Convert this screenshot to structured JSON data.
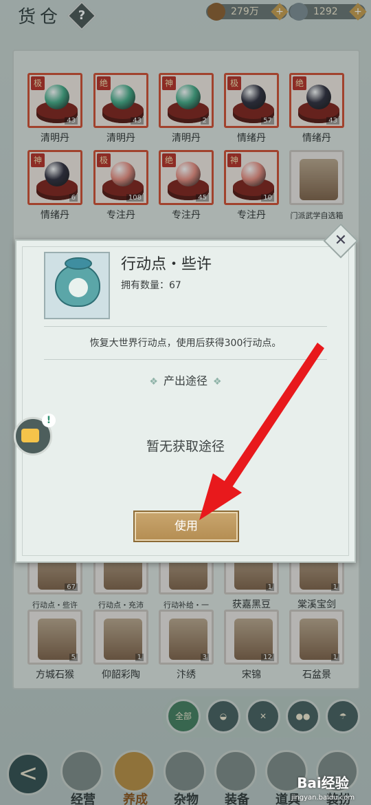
{
  "header": {
    "title": "货仓",
    "help_label": "?",
    "currencies": [
      {
        "icon": "copper-coin-icon",
        "value": "279万",
        "plus": "+"
      },
      {
        "icon": "silver-ingot-icon",
        "value": "1292",
        "plus": "+"
      }
    ]
  },
  "inventory": {
    "items": [
      {
        "name": "清明丹",
        "rank": "极",
        "count": "43",
        "orb_color": "#3fa883"
      },
      {
        "name": "清明丹",
        "rank": "绝",
        "count": "43",
        "orb_color": "#3fa883"
      },
      {
        "name": "清明丹",
        "rank": "神",
        "count": "2",
        "orb_color": "#3fa883"
      },
      {
        "name": "情绪丹",
        "rank": "极",
        "count": "57",
        "orb_color": "#2a2838"
      },
      {
        "name": "情绪丹",
        "rank": "绝",
        "count": "43",
        "orb_color": "#2a2838"
      },
      {
        "name": "情绪丹",
        "rank": "神",
        "count": "6",
        "orb_color": "#2a2838"
      },
      {
        "name": "专注丹",
        "rank": "极",
        "count": "108",
        "orb_color": "#e8897c"
      },
      {
        "name": "专注丹",
        "rank": "绝",
        "count": "45",
        "orb_color": "#e8897c"
      },
      {
        "name": "专注丹",
        "rank": "神",
        "count": "10",
        "orb_color": "#e8897c"
      },
      {
        "name": "门派武学自选箱",
        "rank": "",
        "count": "",
        "orb_color": ""
      },
      {
        "name": "行动点・些许",
        "count": "67"
      },
      {
        "name": "行动点・充沛",
        "count": ""
      },
      {
        "name": "行动补给・一",
        "count": ""
      },
      {
        "name": "获嘉黑豆",
        "count": "1"
      },
      {
        "name": "棠溪宝剑",
        "count": "1"
      },
      {
        "name": "方城石猴",
        "count": "5"
      },
      {
        "name": "仰韶彩陶",
        "count": "1"
      },
      {
        "name": "汴绣",
        "count": "3"
      },
      {
        "name": "宋锦",
        "count": "12"
      },
      {
        "name": "石盆景",
        "count": "1"
      }
    ]
  },
  "filter_tabs": [
    {
      "label": "全部",
      "icon": "all-icon",
      "active": true
    },
    {
      "label": "",
      "icon": "bag-icon",
      "active": false
    },
    {
      "label": "",
      "icon": "tools-icon",
      "active": false
    },
    {
      "label": "",
      "icon": "food-icon",
      "active": false
    },
    {
      "label": "",
      "icon": "umbrella-icon",
      "active": false
    }
  ],
  "bottom_nav": [
    {
      "label": "经营",
      "icon": "bowl-icon",
      "active": false
    },
    {
      "label": "养成",
      "icon": "orb-icon",
      "active": true
    },
    {
      "label": "杂物",
      "icon": "sticks-icon",
      "active": false
    },
    {
      "label": "装备",
      "icon": "robe-icon",
      "active": false
    },
    {
      "label": "道具",
      "icon": "box-icon",
      "active": false
    },
    {
      "label": "装扮",
      "icon": "house-icon",
      "active": false
    }
  ],
  "back_label": "<",
  "modal": {
    "title": "行动点・些许",
    "owned_label": "拥有数量：",
    "owned_value": "67",
    "description": "恢复大世界行动点，使用后获得300行动点。",
    "source_title": "产出途径",
    "source_empty": "暂无获取途径",
    "use_button": "使用",
    "close_label": "✕",
    "icon": "money-bag-icon"
  },
  "chat": {
    "alert": "!"
  },
  "watermark": {
    "brand": "Bai经验",
    "url": "jingyan.baidu.com"
  },
  "colors": {
    "arrow": "#e8191c",
    "accent_gold": "#b48d52"
  }
}
